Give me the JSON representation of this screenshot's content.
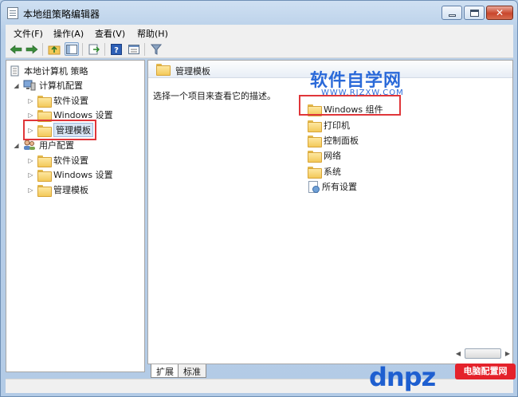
{
  "window": {
    "title": "本地组策略编辑器"
  },
  "menu": [
    "文件(F)",
    "操作(A)",
    "查看(V)",
    "帮助(H)"
  ],
  "toolbar": [
    "back-icon",
    "forward-icon",
    "up-folder-icon",
    "show-hide-tree-icon",
    "export-list-icon",
    "help-icon",
    "properties-icon",
    "filter-icon"
  ],
  "tree": {
    "root": "本地计算机 策略",
    "computer_config": "计算机配置",
    "cc_software": "软件设置",
    "cc_windows": "Windows 设置",
    "cc_admin": "管理模板",
    "user_config": "用户配置",
    "uc_software": "软件设置",
    "uc_windows": "Windows 设置",
    "uc_admin": "管理模板"
  },
  "content": {
    "header": "管理模板",
    "description_prompt": "选择一个项目来查看它的描述。",
    "items": [
      "Windows 组件",
      "打印机",
      "控制面板",
      "网络",
      "系统",
      "所有设置"
    ]
  },
  "tabs": [
    "扩展",
    "标准"
  ],
  "watermarks": {
    "top_title": "软件自学网",
    "top_url": "WWW.RJZXW.COM",
    "bottom_logo": "dnpz",
    "bottom_badge": "电脑配置网"
  },
  "colors": {
    "highlight": "#e0363a",
    "watermark_blue": "#2b6ad9",
    "badge_red": "#e4222b"
  }
}
